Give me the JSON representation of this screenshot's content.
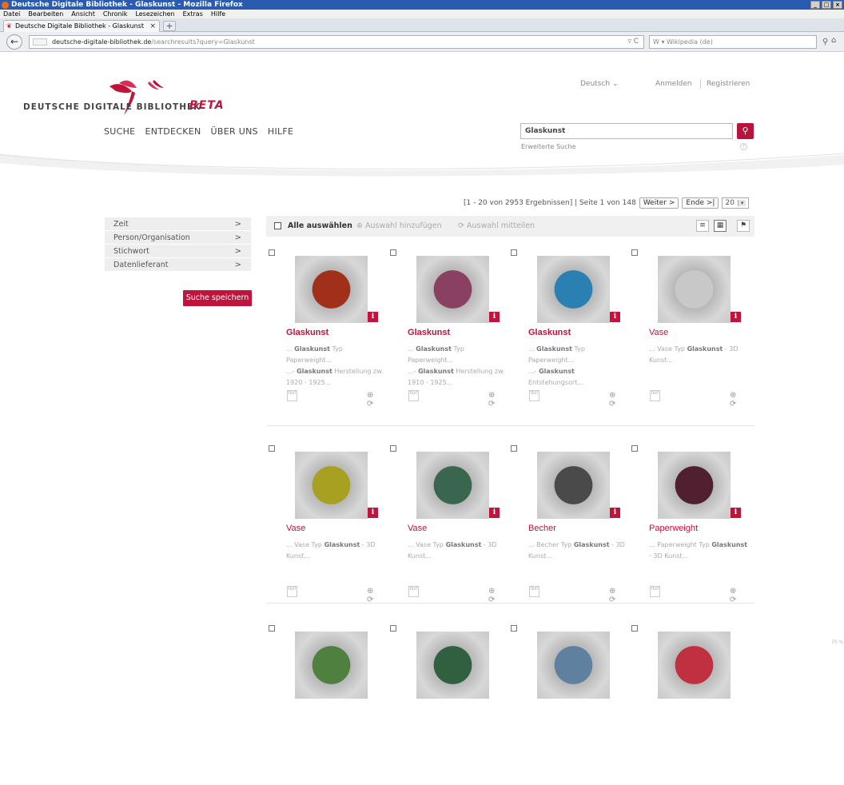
{
  "browser": {
    "window_title": "Deutsche Digitale Bibliothek - Glaskunst - Mozilla Firefox",
    "window_buttons": [
      "_",
      "□",
      "×"
    ],
    "menu": [
      "Datei",
      "Bearbeiten",
      "Ansicht",
      "Chronik",
      "Lesezeichen",
      "Extras",
      "Hilfe"
    ],
    "tab_title": "Deutsche Digitale Bibliothek - Glaskunst",
    "tab_close": "×",
    "new_tab": "+",
    "back": "←",
    "url_host": "deutsche-digitale-bibliothek.de",
    "url_path": "/searchresults?query=Glaskunst",
    "reload": "▿ C",
    "search_engine_text": "W ▾ Wikipedia (de)",
    "search_go": "⚲",
    "home": "⌂"
  },
  "header": {
    "logo_text": "DEUTSCHE DIGITALE BIBLIOTHEK",
    "logo_beta": "BETA",
    "language": "Deutsch ⌄",
    "login": "Anmelden",
    "register": "Registrieren",
    "nav": [
      "SUCHE",
      "ENTDECKEN",
      "ÜBER UNS",
      "HILFE"
    ],
    "search_value": "Glaskunst",
    "search_button": "⚲",
    "advanced_search": "Erweiterte Suche",
    "help_icon": "?"
  },
  "results": {
    "summary": "[1 - 20 von 2953 Ergebnissen] | Seite 1 von 148",
    "next": "Weiter >",
    "end": "Ende >|",
    "per_page": "20",
    "select_arrow": "▾"
  },
  "facets": [
    {
      "label": "Zeit",
      "chevron": ">"
    },
    {
      "label": "Person/Organisation",
      "chevron": ">"
    },
    {
      "label": "Stichwort",
      "chevron": ">"
    },
    {
      "label": "Datenlieferant",
      "chevron": ">"
    }
  ],
  "save_search": "Suche speichern",
  "toolbar": {
    "select_all": "Alle auswählen",
    "add_selection": "Auswahl hinzufügen",
    "share_selection": "Auswahl mitteilen",
    "view_list": "≡",
    "view_grid": "▦",
    "view_extra": "⚑"
  },
  "info_glyph": "i",
  "action_glyphs": "⊕ ⟳",
  "doc_glyph": "TEXT",
  "zoom_text": "70 %",
  "items": [
    {
      "title": "Glaskunst",
      "bold": true,
      "snippet_html": "... <b>Glaskunst</b> Typ Paperweight...<br>...- <b>Glaskunst</b> Herstellung zw. 1920 - 1925...",
      "color": "#a0301a"
    },
    {
      "title": "Glaskunst",
      "bold": true,
      "snippet_html": "... <b>Glaskunst</b> Typ Paperweight...<br>...- <b>Glaskunst</b> Herstellung zw. 1910 - 1925...",
      "color": "#8a4060"
    },
    {
      "title": "Glaskunst",
      "bold": true,
      "snippet_html": "... <b>Glaskunst</b> Typ Paperweight...<br>...- <b>Glaskunst</b><br>Entstehungsort...",
      "color": "#2a80b0"
    },
    {
      "title": "Vase",
      "bold": false,
      "snippet_html": "... Vase Typ <b>Glaskunst</b> - 3D Kunst...",
      "color": "#c8c8c8"
    },
    {
      "title": "Vase",
      "bold": false,
      "snippet_html": "... Vase Typ <b>Glaskunst</b> - 3D Kunst...",
      "color": "#a8a020"
    },
    {
      "title": "Vase",
      "bold": false,
      "snippet_html": "... Vase Typ <b>Glaskunst</b> - 3D Kunst...",
      "color": "#3a6650"
    },
    {
      "title": "Becher",
      "bold": false,
      "snippet_html": "... Becher Typ <b>Glaskunst</b> - 3D Kunst...",
      "color": "#4a4a4a"
    },
    {
      "title": "Paperweight",
      "bold": false,
      "snippet_html": "... Paperweight Typ <b>Glaskunst</b> - 3D Kunst...",
      "color": "#502030"
    },
    {
      "title": "",
      "bold": false,
      "snippet_html": "",
      "color": "#508040"
    },
    {
      "title": "",
      "bold": false,
      "snippet_html": "",
      "color": "#306040"
    },
    {
      "title": "",
      "bold": false,
      "snippet_html": "",
      "color": "#6080a0"
    },
    {
      "title": "",
      "bold": false,
      "snippet_html": "",
      "color": "#c03040"
    }
  ]
}
